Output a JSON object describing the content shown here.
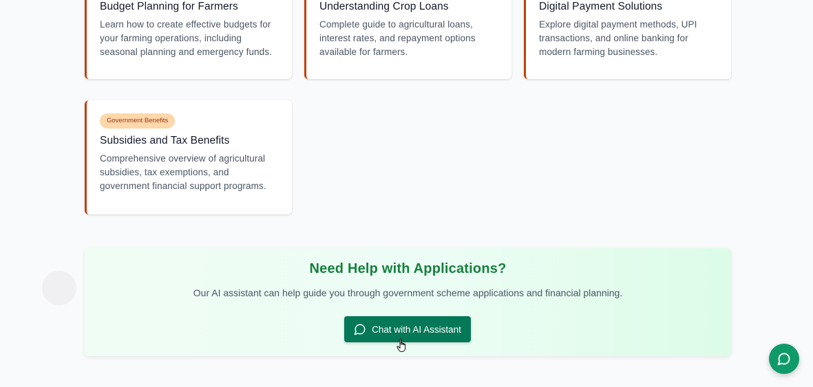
{
  "cards": [
    {
      "title": "Budget Planning for Farmers",
      "description": "Learn how to create effective budgets for your farming operations, including seasonal planning and emergency funds."
    },
    {
      "title": "Understanding Crop Loans",
      "description": "Complete guide to agricultural loans, interest rates, and repayment options available for farmers."
    },
    {
      "title": "Digital Payment Solutions",
      "description": "Explore digital payment methods, UPI transactions, and online banking for modern farming businesses."
    },
    {
      "badge": "Government Benefits",
      "title": "Subsidies and Tax Benefits",
      "description": "Comprehensive overview of agricultural subsidies, tax exemptions, and government financial support programs."
    }
  ],
  "help": {
    "title": "Need Help with Applications?",
    "description": "Our AI assistant can help guide you through government scheme applications and financial planning.",
    "button_label": "Chat with AI Assistant",
    "button_icon": "chat-bubble-icon"
  },
  "fab": {
    "icon": "chat-bubble-icon"
  },
  "colors": {
    "accent_border": "#c2410c",
    "badge_bg": "#fed7aa",
    "badge_text": "#9a3412",
    "heading_green": "#15803d",
    "button_green": "#047857",
    "fab_green": "#0f9a6a"
  }
}
